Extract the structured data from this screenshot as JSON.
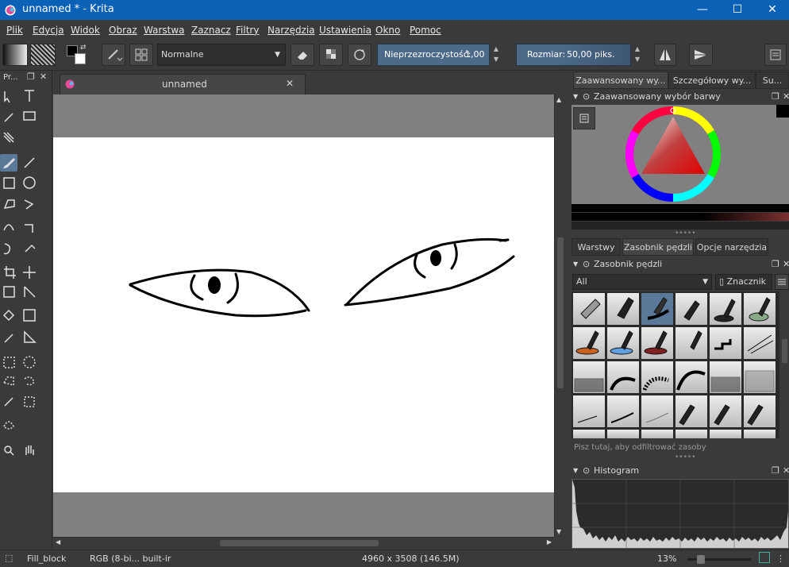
{
  "window": {
    "title": "unnamed * - Krita",
    "minimize_glyph": "—",
    "maximize_glyph": "☐",
    "close_glyph": "✕"
  },
  "menu": [
    "Plik",
    "Edycja",
    "Widok",
    "Obraz",
    "Warstwa",
    "Zaznacz",
    "Filtry",
    "Narzędzia",
    "Ustawienia",
    "Okno",
    "Pomoc"
  ],
  "toolbar": {
    "blend_mode": "Normalne",
    "opacity_label": "Nieprzezroczystość:",
    "opacity_value": "1,00",
    "size_label": "Rozmiar:",
    "size_value": "50,00 piks."
  },
  "toolbox": {
    "title": "Pr...",
    "tools": [
      "select-shapes-icon",
      "text-tool-icon",
      "calligraphy-icon",
      "edit-shapes-icon",
      "pattern-icon",
      "freehand-brush-icon",
      "line-tool-icon",
      "rectangle-tool-icon",
      "ellipse-tool-icon",
      "polygon-tool-icon",
      "polyline-tool-icon",
      "bezier-tool-icon",
      "freehand-path-icon",
      "dynamic-brush-icon",
      "multibrush-icon",
      "crop-icon",
      "move-icon",
      "transform-icon",
      "measure-icon",
      "fill-icon",
      "gradient-icon",
      "color-picker-icon",
      "assistant-icon",
      "rect-select-icon",
      "ellipse-select-icon",
      "polygon-select-icon",
      "freehand-select-icon",
      "magic-wand-icon",
      "similar-select-icon",
      "bezier-select-icon",
      "zoom-icon",
      "pan-icon"
    ]
  },
  "document": {
    "tab_title": "unnamed"
  },
  "docker": {
    "tabs_top": [
      "Zaawansowany wy...",
      "Szczegółowy wy...",
      "Su..."
    ],
    "color_selector_title": "Zaawansowany wybór barwy",
    "tabs_mid": [
      "Warstwy",
      "Zasobnik pędzli",
      "Opcje narzędzia"
    ],
    "brush_title": "Zasobnik pędzli",
    "brush_filter": "All",
    "tag_label": "Znacznik",
    "search_placeholder": "Pisz tutaj, aby odfiltrować zasoby",
    "histogram_title": "Histogram"
  },
  "status": {
    "brush_name": "Fill_block",
    "color_space": "RGB (8-bi... built-ir",
    "dimensions": "4960 x 3508 (146.5M)",
    "zoom": "13%"
  },
  "colors": {
    "titlebar": "#0a61b5",
    "panel": "#3a3a3a",
    "accent": "#5a7897",
    "slider": "#4d6a8a"
  }
}
